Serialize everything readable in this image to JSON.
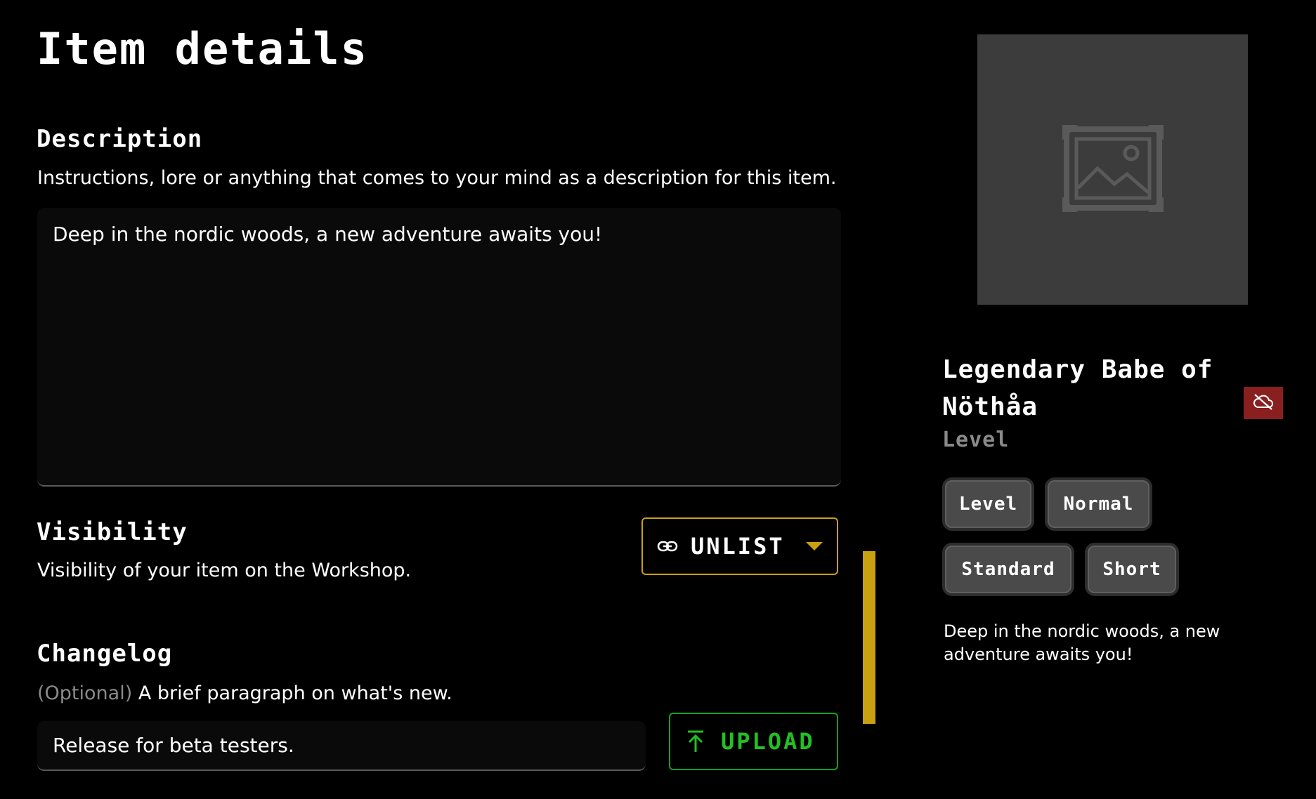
{
  "page": {
    "title": "Item details"
  },
  "description": {
    "title": "Description",
    "help": "Instructions, lore or anything that comes to your mind as a description for this item.",
    "value": "Deep in the nordic woods, a new adventure awaits you!"
  },
  "visibility": {
    "title": "Visibility",
    "help": "Visibility of your item on the Workshop.",
    "selected": "UNLIST",
    "icon": "link-icon",
    "accent": "#c9a010"
  },
  "changelog": {
    "title": "Changelog",
    "optional_label": "(Optional)",
    "help": "A brief paragraph on what's new.",
    "value": "Release for beta testers."
  },
  "upload": {
    "label": "UPLOAD",
    "icon": "upload-arrow-icon",
    "accent": "#22c022"
  },
  "preview": {
    "thumbnail_icon": "image-placeholder-icon",
    "title": "Legendary Babe of Nöthåa",
    "type": "Level",
    "visibility_icon": "cloud-off-icon",
    "visibility_badge_color": "#8a1f1f",
    "tags": [
      "Level",
      "Normal",
      "Standard",
      "Short"
    ],
    "description": "Deep in the nordic woods, a new adventure awaits you!"
  }
}
